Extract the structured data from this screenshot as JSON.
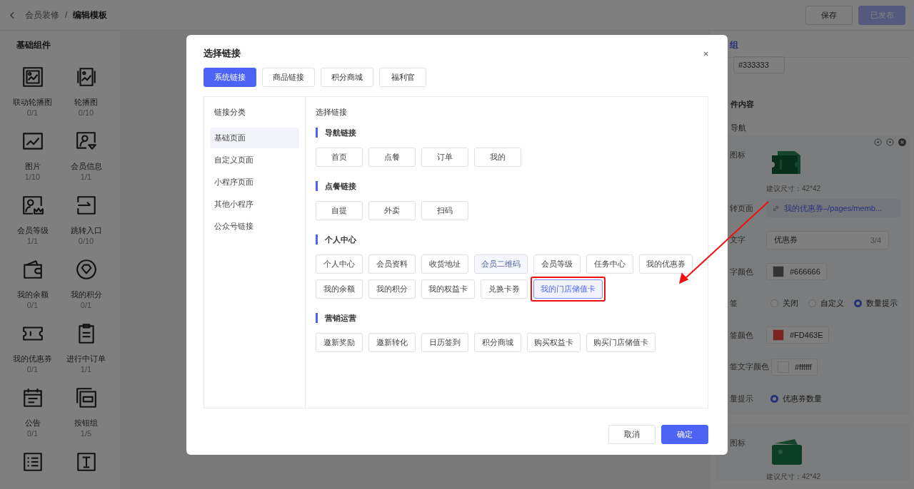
{
  "header": {
    "breadcrumb": [
      "会员装修",
      "编辑模板"
    ],
    "separator": "/",
    "buttons": [
      {
        "label": "保存",
        "kind": "default",
        "disabled": false
      },
      {
        "label": "已发布",
        "kind": "primary",
        "disabled": true
      }
    ]
  },
  "sidebar": {
    "title": "基础组件",
    "items": [
      {
        "label": "联动轮播图",
        "count": "0/1"
      },
      {
        "label": "轮播图",
        "count": "0/10"
      },
      {
        "label": "图片",
        "count": "1/10"
      },
      {
        "label": "会员信息",
        "count": "1/1"
      },
      {
        "label": "会员等级",
        "count": "1/1"
      },
      {
        "label": "跳转入口",
        "count": "0/10"
      },
      {
        "label": "我的余额",
        "count": "0/1"
      },
      {
        "label": "我的积分",
        "count": "0/1"
      },
      {
        "label": "我的优惠券",
        "count": "0/1"
      },
      {
        "label": "进行中订单",
        "count": "1/1"
      },
      {
        "label": "公告",
        "count": "0/1"
      },
      {
        "label": "按钮组",
        "count": "1/5"
      }
    ]
  },
  "settings": {
    "tab": "组",
    "color_value": "#333333",
    "section_title": "件内容",
    "subsection": "导航",
    "cards": [
      {
        "rows": [
          {
            "kind": "image",
            "label": "图标",
            "hint": "建议尺寸：42*42"
          },
          {
            "kind": "link",
            "label": "转页面",
            "value": "我的优惠券–/pages/memb..."
          },
          {
            "kind": "text",
            "label": "文字",
            "value": "优惠券",
            "counter": "3/4"
          },
          {
            "kind": "color",
            "label": "字颜色",
            "value": "#666666"
          },
          {
            "kind": "radio",
            "label": "签",
            "options": [
              {
                "label": "关闭",
                "selected": false
              },
              {
                "label": "自定义",
                "selected": false
              },
              {
                "label": "数量提示",
                "selected": true
              }
            ]
          },
          {
            "kind": "color",
            "label": "签颜色",
            "value": "#FD463E"
          },
          {
            "kind": "color",
            "label": "签文字颜色",
            "value": "#ffffff"
          },
          {
            "kind": "radio",
            "label": "量提示",
            "options": [
              {
                "label": "优惠券数量",
                "selected": true
              }
            ]
          }
        ]
      },
      {
        "rows": [
          {
            "kind": "image",
            "label": "图标",
            "hint": "建议尺寸：42*42"
          }
        ]
      }
    ]
  },
  "modal": {
    "title": "选择链接",
    "tabs": [
      {
        "label": "系统链接",
        "selected": true
      },
      {
        "label": "商品链接",
        "selected": false
      },
      {
        "label": "积分商城",
        "selected": false
      },
      {
        "label": "福利官",
        "selected": false
      }
    ],
    "categories": {
      "title": "链接分类",
      "items": [
        {
          "label": "基础页面",
          "selected": true
        },
        {
          "label": "自定义页面",
          "selected": false
        },
        {
          "label": "小程序页面",
          "selected": false
        },
        {
          "label": "其他小程序",
          "selected": false
        },
        {
          "label": "公众号链接",
          "selected": false
        }
      ]
    },
    "links_title": "选择链接",
    "groups": [
      {
        "title": "导航链接",
        "links": [
          {
            "label": "首页",
            "selected": false,
            "hovered": false
          },
          {
            "label": "点餐",
            "selected": false,
            "hovered": false
          },
          {
            "label": "订单",
            "selected": false,
            "hovered": false
          },
          {
            "label": "我的",
            "selected": false,
            "hovered": false
          }
        ]
      },
      {
        "title": "点餐链接",
        "links": [
          {
            "label": "自提",
            "selected": false,
            "hovered": false
          },
          {
            "label": "外卖",
            "selected": false,
            "hovered": false
          },
          {
            "label": "扫码",
            "selected": false,
            "hovered": false
          }
        ]
      },
      {
        "title": "个人中心",
        "links": [
          {
            "label": "个人中心",
            "selected": false,
            "hovered": false
          },
          {
            "label": "会员资料",
            "selected": false,
            "hovered": false
          },
          {
            "label": "收货地址",
            "selected": false,
            "hovered": false
          },
          {
            "label": "会员二维码",
            "selected": false,
            "hovered": true
          },
          {
            "label": "会员等级",
            "selected": false,
            "hovered": false
          },
          {
            "label": "任务中心",
            "selected": false,
            "hovered": false
          },
          {
            "label": "我的优惠券",
            "selected": false,
            "hovered": false
          },
          {
            "label": "我的余额",
            "selected": false,
            "hovered": false
          },
          {
            "label": "我的积分",
            "selected": false,
            "hovered": false
          },
          {
            "label": "我的权益卡",
            "selected": false,
            "hovered": false
          },
          {
            "label": "兑换卡券",
            "selected": false,
            "hovered": false
          },
          {
            "label": "我的门店储值卡",
            "selected": true,
            "hovered": false
          }
        ]
      },
      {
        "title": "营销运营",
        "links": [
          {
            "label": "邀新奖励",
            "selected": false,
            "hovered": false
          },
          {
            "label": "邀新转化",
            "selected": false,
            "hovered": false
          },
          {
            "label": "日历签到",
            "selected": false,
            "hovered": false
          },
          {
            "label": "积分商城",
            "selected": false,
            "hovered": false
          },
          {
            "label": "购买权益卡",
            "selected": false,
            "hovered": false
          },
          {
            "label": "购买门店储值卡",
            "selected": false,
            "hovered": false
          }
        ]
      }
    ],
    "buttons": [
      {
        "label": "取消",
        "kind": "default"
      },
      {
        "label": "确定",
        "kind": "primary"
      }
    ]
  }
}
